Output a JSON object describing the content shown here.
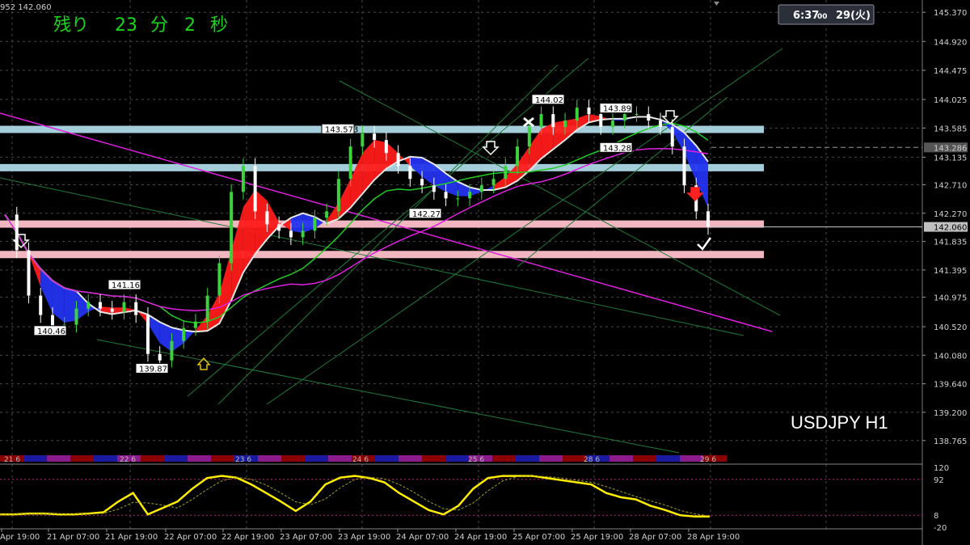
{
  "header": {
    "top_left_text": "952 142.060",
    "countdown_prefix": "残り",
    "countdown_min": "23",
    "countdown_min_unit": "分",
    "countdown_sec": "2",
    "countdown_sec_unit": "秒",
    "clock_time": "6:37",
    "clock_seconds": "00",
    "clock_date": "29(火)"
  },
  "symbol_label": "USDJPY H1",
  "colors": {
    "background": "#000000",
    "grid": "#4a4a4a",
    "bull_candle": "#3cd23c",
    "bear_candle": "#ffffff",
    "ribbon_up": "#ff1a1a",
    "ribbon_down": "#2233ee",
    "ma_white": "#e8e8e8",
    "ma_green": "#22cc22",
    "ma_magenta": "#e020e0",
    "zone_blue": "#add8e6",
    "zone_pink": "#ffc0cb",
    "osc_line": "#ffee00",
    "current_price_bg": "#c0c0c0"
  },
  "chart_data": [
    {
      "type": "candlestick",
      "title": "USDJPY H1",
      "y_axis_ticks": [
        "145.370",
        "144.920",
        "144.475",
        "144.025",
        "143.585",
        "143.135",
        "142.710",
        "142.270",
        "141.835",
        "141.395",
        "140.975",
        "140.520",
        "140.080",
        "139.640",
        "139.200",
        "138.765"
      ],
      "ylim": [
        138.6,
        145.46
      ],
      "current_price": "142.060",
      "prev_close_line": "143.286",
      "x_axis_ticks": [
        "Apr 19:00",
        "21 Apr 07:00",
        "21 Apr 19:00",
        "22 Apr 07:00",
        "22 Apr 19:00",
        "23 Apr 07:00",
        "23 Apr 19:00",
        "24 Apr 07:00",
        "24 Apr 19:00",
        "25 Apr 07:00",
        "25 Apr 19:00",
        "28 Apr 07:00",
        "28 Apr 19:00"
      ],
      "day_bar_labels": [
        "21 6",
        "22 6",
        "23 6",
        "24 6",
        "25 6",
        "28 6",
        "29 6"
      ],
      "annotations": [
        {
          "label": "143.573",
          "value": 143.573
        },
        {
          "label": "144.028",
          "value": 144.028
        },
        {
          "label": "143.893",
          "value": 143.893
        },
        {
          "label": "143.286",
          "value": 143.286
        },
        {
          "label": "142.270",
          "value": 142.27
        },
        {
          "label": "141.169",
          "value": 141.169
        },
        {
          "label": "140.461",
          "value": 140.461
        },
        {
          "label": "139.879",
          "value": 139.879
        }
      ],
      "zones": [
        {
          "color": "blue",
          "value": 143.57
        },
        {
          "color": "blue",
          "value": 142.98
        },
        {
          "color": "pink",
          "value": 142.11
        },
        {
          "color": "pink",
          "value": 141.64
        }
      ],
      "price_path": [
        142.25,
        141.7,
        141.0,
        140.7,
        140.5,
        140.55,
        140.8,
        140.9,
        140.8,
        140.75,
        140.9,
        140.7,
        140.1,
        140.0,
        140.3,
        140.5,
        140.6,
        141.0,
        141.5,
        142.6,
        143.0,
        142.3,
        142.1,
        142.0,
        141.9,
        142.0,
        142.2,
        142.3,
        142.8,
        143.3,
        143.5,
        143.4,
        143.2,
        143.0,
        142.8,
        142.7,
        142.6,
        142.5,
        142.5,
        142.6,
        142.7,
        142.8,
        143.0,
        143.3,
        143.6,
        143.8,
        143.6,
        143.7,
        143.9,
        143.8,
        143.6,
        143.7,
        143.8,
        143.8,
        143.7,
        143.6,
        143.3,
        142.7,
        142.3,
        142.06
      ]
    },
    {
      "type": "line",
      "title": "",
      "y_axis_ticks": [
        "120",
        "92",
        "8",
        "-20"
      ],
      "ylim": [
        -20,
        120
      ],
      "levels": [
        92,
        8
      ],
      "series": [
        {
          "values": [
            10,
            10,
            12,
            12,
            10,
            10,
            12,
            15,
            40,
            60,
            10,
            25,
            40,
            70,
            95,
            100,
            96,
            80,
            60,
            40,
            18,
            40,
            80,
            96,
            100,
            95,
            85,
            60,
            40,
            20,
            10,
            30,
            70,
            95,
            100,
            100,
            100,
            95,
            90,
            85,
            80,
            60,
            50,
            45,
            30,
            20,
            8,
            5,
            5
          ]
        }
      ]
    }
  ]
}
